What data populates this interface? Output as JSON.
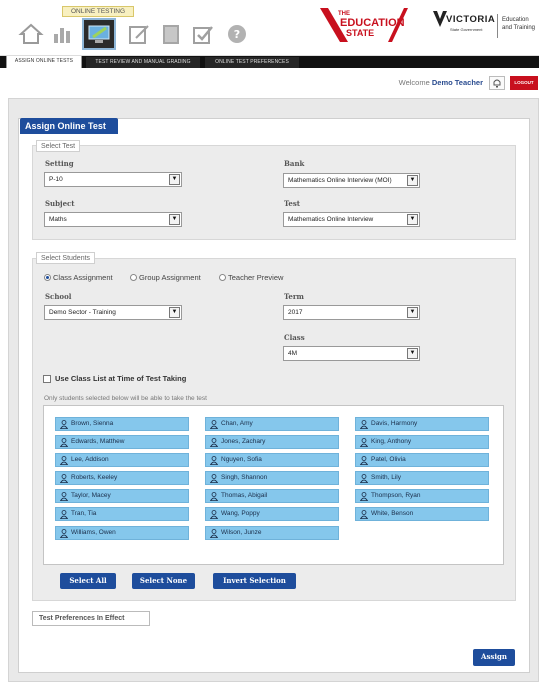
{
  "header": {
    "online_testing_label": "ONLINE TESTING",
    "edu_logo": {
      "line1": "THE",
      "line2": "EDUCATION",
      "line3": "STATE"
    },
    "vic_logo": {
      "name": "VICTORIA",
      "sub": "State Government",
      "dept": "Education and Training"
    },
    "toolbar_icons": [
      "home-icon",
      "chart-icon",
      "online-testing-icon",
      "review-icon",
      "book-icon",
      "check-icon",
      "help-icon"
    ]
  },
  "tabs": [
    {
      "label": "ASSIGN ONLINE TESTS",
      "active": true
    },
    {
      "label": "TEST REVIEW AND MANUAL GRADING",
      "active": false
    },
    {
      "label": "ONLINE TEST PREFERENCES",
      "active": false
    }
  ],
  "welcome": {
    "prefix": "Welcome",
    "user": "Demo Teacher",
    "logout": "LOGOUT"
  },
  "panel": {
    "title": "Assign Online Test"
  },
  "select_test": {
    "title": "Select Test",
    "setting": {
      "label": "Setting",
      "value": "P-10"
    },
    "bank": {
      "label": "Bank",
      "value": "Mathematics Online Interview (MOI)"
    },
    "subject": {
      "label": "Subject",
      "value": "Maths"
    },
    "test": {
      "label": "Test",
      "value": "Mathematics Online Interview"
    }
  },
  "select_students": {
    "title": "Select Students",
    "radios": [
      {
        "label": "Class Assignment",
        "checked": true
      },
      {
        "label": "Group Assignment",
        "checked": false
      },
      {
        "label": "Teacher Preview",
        "checked": false
      }
    ],
    "school": {
      "label": "School",
      "value": "Demo Sector - Training"
    },
    "term": {
      "label": "Term",
      "value": "2017"
    },
    "class": {
      "label": "Class",
      "value": "4M"
    },
    "use_class_list": "Use Class List at Time of Test Taking",
    "note": "Only students selected below will be able to take the test",
    "students": [
      [
        "Brown, Sienna",
        "Chan, Amy",
        "Davis, Harmony"
      ],
      [
        "Edwards, Matthew",
        "Jones, Zachary",
        "King, Anthony"
      ],
      [
        "Lee, Addison",
        "Nguyen, Sofia",
        "Patel, Olivia"
      ],
      [
        "Roberts, Keeley",
        "Singh, Shannon",
        "Smith, Lily"
      ],
      [
        "Taylor, Macey",
        "Thomas, Abigail",
        "Thompson, Ryan"
      ],
      [
        "Tran, Tia",
        "Wang, Poppy",
        "White, Benson"
      ],
      [
        "Williams, Owen",
        "Wilson, Junze",
        ""
      ]
    ],
    "buttons": {
      "select_all": "Select All",
      "select_none": "Select None",
      "invert": "Invert Selection"
    }
  },
  "prefs_in_effect": "Test Preferences In Effect",
  "assign_button": "Assign",
  "colors": {
    "brand_blue": "#1e4d9c",
    "student_chip": "#85c7ec",
    "logout_red": "#c8101e"
  }
}
